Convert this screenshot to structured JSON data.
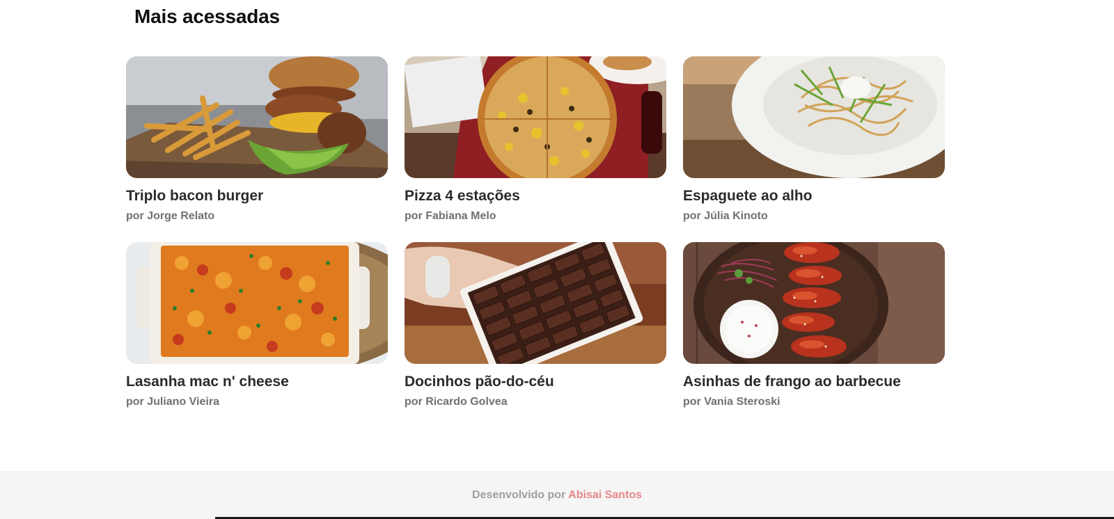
{
  "section": {
    "title": "Mais acessadas"
  },
  "recipes": [
    {
      "title": "Triplo bacon burger",
      "author": "por Jorge Relato",
      "image": "burger-image"
    },
    {
      "title": "Pizza 4 estações",
      "author": "por Fabiana Melo",
      "image": "pizza-image"
    },
    {
      "title": "Espaguete ao alho",
      "author": "por Júlia Kinoto",
      "image": "spaghetti-image"
    },
    {
      "title": "Lasanha mac n' cheese",
      "author": "por Juliano Vieira",
      "image": "lasagna-image"
    },
    {
      "title": "Docinhos pão-do-céu",
      "author": "por Ricardo Golvea",
      "image": "chocolates-image"
    },
    {
      "title": "Asinhas de frango ao barbecue",
      "author": "por Vania Steroski",
      "image": "chicken-wings-image"
    }
  ],
  "footer": {
    "prefix": "Desenvolvido por",
    "link_label": "Abisai Santos"
  },
  "colors": {
    "link": "#e58787",
    "footer_bg": "#f5f5f5",
    "title": "#2b2b2b",
    "author": "#707070"
  }
}
